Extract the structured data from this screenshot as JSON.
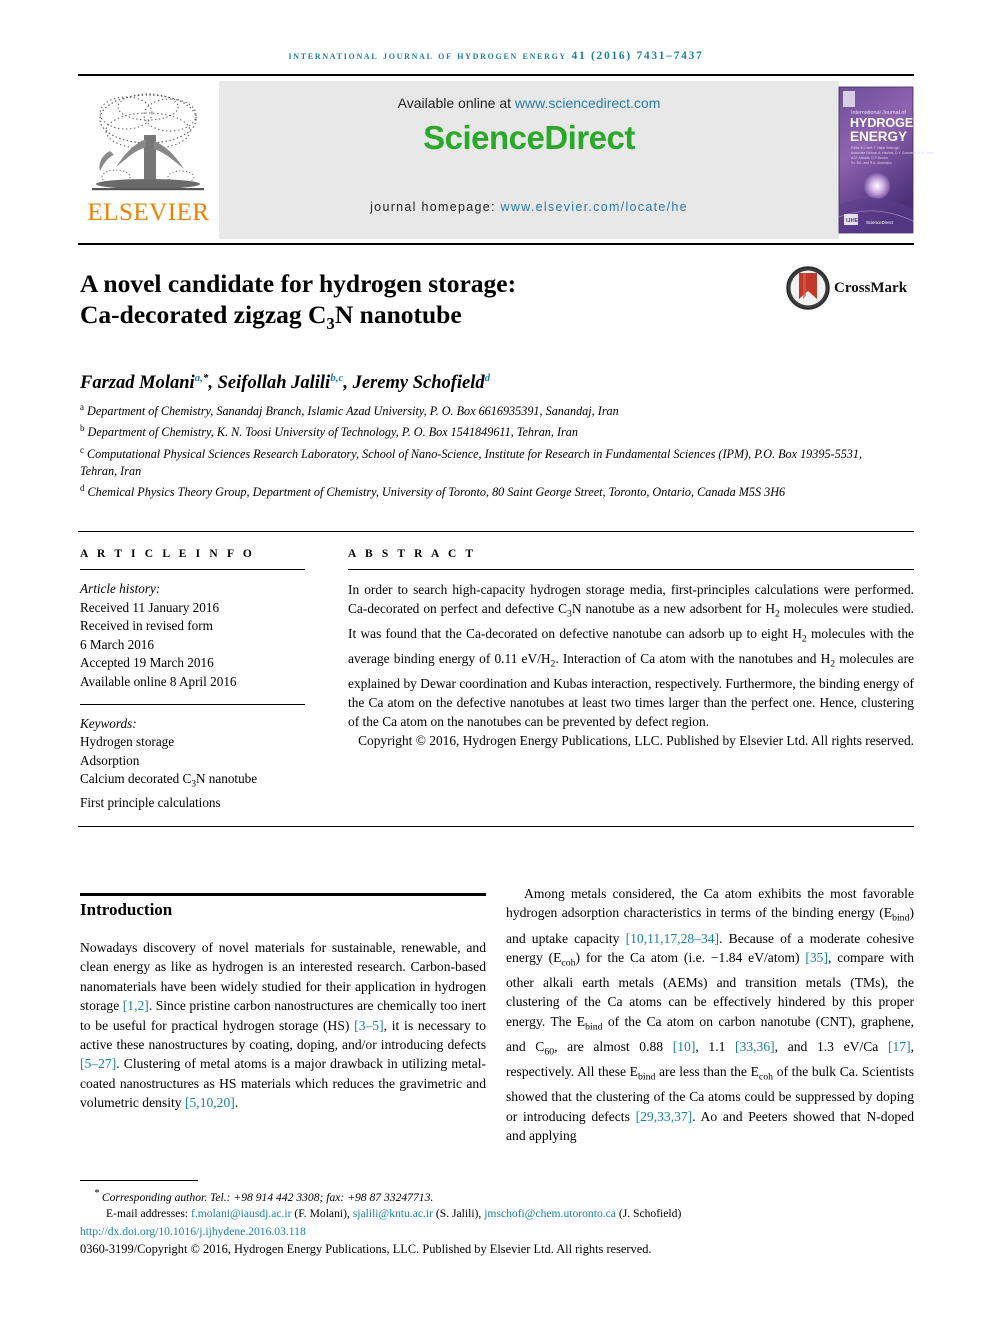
{
  "running_head": "International Journal of Hydrogen Energy 41 (2016) 7431–7437",
  "masthead": {
    "available_prefix": "Available online at ",
    "sciencedirect_url": "www.sciencedirect.com",
    "sciencedirect_logo": "ScienceDirect",
    "homepage_prefix": "journal homepage: ",
    "homepage_url": "www.elsevier.com/locate/he",
    "publisher_logo_text": "ELSEVIER",
    "cover_title_small": "International Journal of",
    "cover_title_line1": "HYDROGEN",
    "cover_title_line2": "ENERGY"
  },
  "crossmark": {
    "label": "CrossMark"
  },
  "article": {
    "title_line1": "A novel candidate for hydrogen storage:",
    "title_line2_pre": "Ca-decorated zigzag C",
    "title_line2_sub": "3",
    "title_line2_post": "N nanotube",
    "authors": [
      {
        "name": "Farzad Molani",
        "marks": "a,",
        "star": "*"
      },
      {
        "name": "Seifollah Jalili",
        "marks": "b,c",
        "star": ""
      },
      {
        "name": "Jeremy Schofield",
        "marks": "d",
        "star": ""
      }
    ],
    "affiliations": [
      {
        "mark": "a",
        "text": "Department of Chemistry, Sanandaj Branch, Islamic Azad University, P. O. Box 6616935391, Sanandaj, Iran"
      },
      {
        "mark": "b",
        "text": "Department of Chemistry, K. N. Toosi University of Technology, P. O. Box 1541849611, Tehran, Iran"
      },
      {
        "mark": "c",
        "text": "Computational Physical Sciences Research Laboratory, School of Nano-Science, Institute for Research in Fundamental Sciences (IPM), P.O. Box 19395-5531, Tehran, Iran"
      },
      {
        "mark": "d",
        "text": "Chemical Physics Theory Group, Department of Chemistry, University of Toronto, 80 Saint George Street, Toronto, Ontario, Canada M5S 3H6"
      }
    ]
  },
  "info": {
    "heading": "A R T I C L E   I N F O",
    "history_head": "Article history:",
    "history": [
      "Received 11 January 2016",
      "Received in revised form",
      "6 March 2016",
      "Accepted 19 March 2016",
      "Available online 8 April 2016"
    ],
    "keywords_head": "Keywords:",
    "keywords": [
      "Hydrogen storage",
      "Adsorption",
      "Calcium decorated C3N nanotube",
      "First principle calculations"
    ]
  },
  "abstract": {
    "heading": "A B S T R A C T",
    "text": "In order to search high-capacity hydrogen storage media, first-principles calculations were performed. Ca-decorated on perfect and defective C3N nanotube as a new adsorbent for H2 molecules were studied. It was found that the Ca-decorated on defective nanotube can adsorb up to eight H2 molecules with the average binding energy of 0.11 eV/H2. Interaction of Ca atom with the nanotubes and H2 molecules are explained by Dewar coordination and Kubas interaction, respectively. Furthermore, the binding energy of the Ca atom on the defective nanotubes at least two times larger than the perfect one. Hence, clustering of the Ca atom on the nanotubes can be prevented by defect region.",
    "copyright": "Copyright © 2016, Hydrogen Energy Publications, LLC. Published by Elsevier Ltd. All rights reserved."
  },
  "introduction": {
    "heading": "Introduction",
    "left_paragraph": "Nowadays discovery of novel materials for sustainable, renewable, and clean energy as like as hydrogen is an interested research. Carbon-based nanomaterials have been widely studied for their application in hydrogen storage [1,2]. Since pristine carbon nanostructures are chemically too inert to be useful for practical hydrogen storage (HS) [3–5], it is necessary to active these nanostructures by coating, doping, and/or introducing defects [5–27]. Clustering of metal atoms is a major drawback in utilizing metal-coated nanostructures as HS materials which reduces the gravimetric and volumetric density [5,10,20].",
    "right_paragraph": "Among metals considered, the Ca atom exhibits the most favorable hydrogen adsorption characteristics in terms of the binding energy (Ebind) and uptake capacity [10,11,17,28–34]. Because of a moderate cohesive energy (Ecoh) for the Ca atom (i.e. −1.84 eV/atom) [35], compare with other alkali earth metals (AEMs) and transition metals (TMs), the clustering of the Ca atoms can be effectively hindered by this proper energy. The Ebind of the Ca atom on carbon nanotube (CNT), graphene, and C60, are almost 0.88 [10], 1.1 [33,36], and 1.3 eV/Ca [17], respectively. All these Ebind are less than the Ecoh of the bulk Ca. Scientists showed that the clustering of the Ca atoms could be suppressed by doping or introducing defects [29,33,37]. Ao and Peeters showed that N-doped and applying"
  },
  "footer": {
    "corresponding": "Corresponding author. Tel.: +98 914 442 3308; fax: +98 87 33247713.",
    "email_label": "E-mail addresses:",
    "emails": [
      {
        "address": "f.molani@iausdj.ac.ir",
        "owner": "(F. Molani)"
      },
      {
        "address": "sjalili@kntu.ac.ir",
        "owner": "(S. Jalili)"
      },
      {
        "address": "jmschofi@chem.utoronto.ca",
        "owner": "(J. Schofield)"
      }
    ],
    "doi": "http://dx.doi.org/10.1016/j.ijhydene.2016.03.118",
    "issn_copyright": "0360-3199/Copyright © 2016, Hydrogen Energy Publications, LLC. Published by Elsevier Ltd. All rights reserved."
  },
  "colors": {
    "link": "#1a7fa8",
    "sciencedirect_green": "#2aa82a",
    "elsevier_orange": "#f08000",
    "band_gray": "#e8e8e8"
  }
}
